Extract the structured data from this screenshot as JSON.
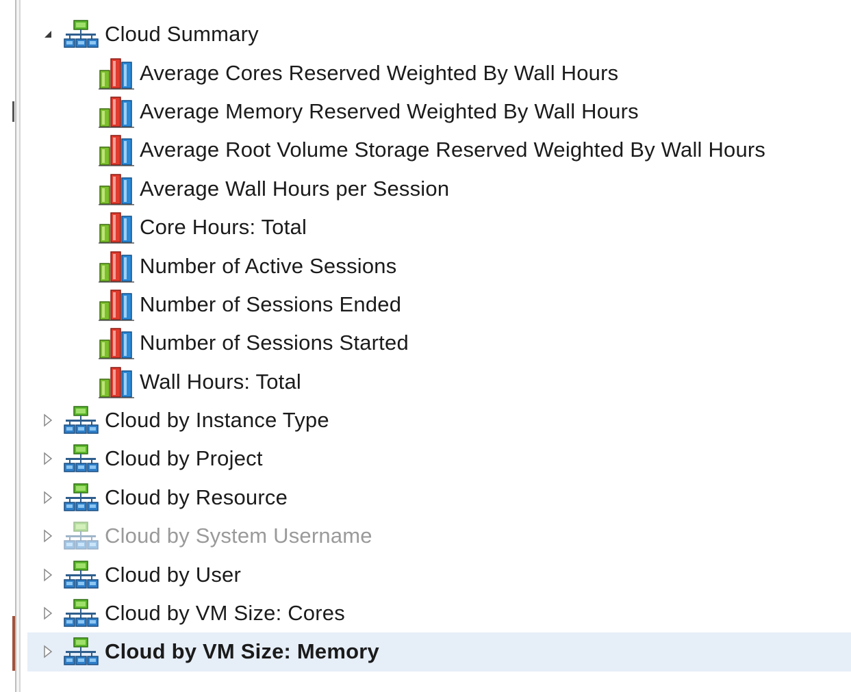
{
  "tree": {
    "root": {
      "label": "Cloud Summary",
      "expanded": true,
      "icon": "network-group-icon",
      "children": [
        {
          "label": "Average Cores Reserved Weighted By Wall Hours",
          "icon": "bar-chart-icon"
        },
        {
          "label": "Average Memory Reserved Weighted By Wall Hours",
          "icon": "bar-chart-icon"
        },
        {
          "label": "Average Root Volume Storage Reserved Weighted By Wall Hours",
          "icon": "bar-chart-icon"
        },
        {
          "label": "Average Wall Hours per Session",
          "icon": "bar-chart-icon"
        },
        {
          "label": "Core Hours: Total",
          "icon": "bar-chart-icon"
        },
        {
          "label": "Number of Active Sessions",
          "icon": "bar-chart-icon"
        },
        {
          "label": "Number of Sessions Ended",
          "icon": "bar-chart-icon"
        },
        {
          "label": "Number of Sessions Started",
          "icon": "bar-chart-icon"
        },
        {
          "label": "Wall Hours: Total",
          "icon": "bar-chart-icon"
        }
      ]
    },
    "groups": [
      {
        "label": "Cloud by Instance Type",
        "expanded": false,
        "disabled": false,
        "selected": false
      },
      {
        "label": "Cloud by Project",
        "expanded": false,
        "disabled": false,
        "selected": false
      },
      {
        "label": "Cloud by Resource",
        "expanded": false,
        "disabled": false,
        "selected": false
      },
      {
        "label": "Cloud by System Username",
        "expanded": false,
        "disabled": true,
        "selected": false
      },
      {
        "label": "Cloud by User",
        "expanded": false,
        "disabled": false,
        "selected": false
      },
      {
        "label": "Cloud by VM Size: Cores",
        "expanded": false,
        "disabled": false,
        "selected": false
      },
      {
        "label": "Cloud by VM Size: Memory",
        "expanded": false,
        "disabled": false,
        "selected": true
      }
    ]
  },
  "colors": {
    "selected_row_bg": "#e6eef8",
    "disabled_text": "#9a9a9a",
    "text": "#1b1b1b",
    "network_icon_green": "#5cb82c",
    "network_icon_blue": "#2f7fc9",
    "chart_green": "#7cbf2d",
    "chart_red": "#e03b2e",
    "chart_blue": "#2b8ad8"
  }
}
